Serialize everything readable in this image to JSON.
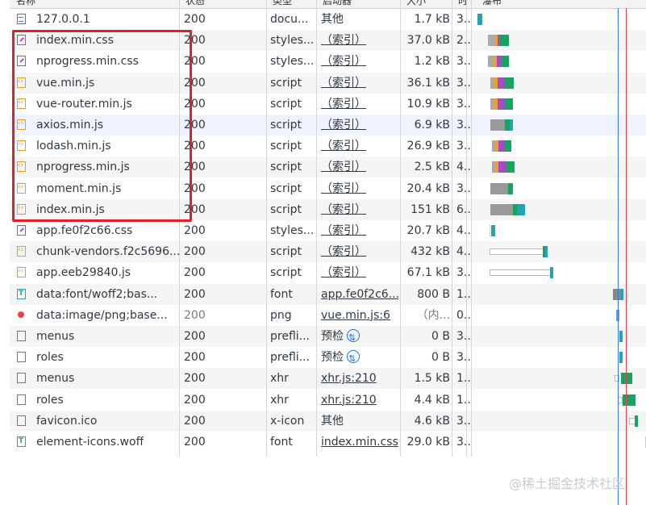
{
  "header": {
    "name": "名称",
    "status": "状态",
    "type": "类型",
    "initiator": "启动器",
    "size": "大小",
    "time": "时",
    "waterfall": "瀑布"
  },
  "rows": [
    {
      "name": "127.0.0.1",
      "icon": "document-icon",
      "status": "200",
      "type": "docu...",
      "initiator": "其他",
      "init_link": false,
      "size": "1.7 kB",
      "time": "3..."
    },
    {
      "name": "index.min.css",
      "icon": "stylesheet-icon",
      "status": "200",
      "type": "styles...",
      "initiator": "（索引）",
      "init_link": true,
      "size": "37.0 kB",
      "time": "2..."
    },
    {
      "name": "nprogress.min.css",
      "icon": "stylesheet-icon",
      "status": "200",
      "type": "styles...",
      "initiator": "（索引）",
      "init_link": true,
      "size": "1.2 kB",
      "time": "3..."
    },
    {
      "name": "vue.min.js",
      "icon": "script-icon",
      "status": "200",
      "type": "script",
      "initiator": "（索引）",
      "init_link": true,
      "size": "36.1 kB",
      "time": "3..."
    },
    {
      "name": "vue-router.min.js",
      "icon": "script-icon",
      "status": "200",
      "type": "script",
      "initiator": "（索引）",
      "init_link": true,
      "size": "10.9 kB",
      "time": "3..."
    },
    {
      "name": "axios.min.js",
      "icon": "script-icon",
      "status": "200",
      "type": "script",
      "initiator": "（索引）",
      "init_link": true,
      "size": "6.9 kB",
      "time": "3..."
    },
    {
      "name": "lodash.min.js",
      "icon": "script-icon",
      "status": "200",
      "type": "script",
      "initiator": "（索引）",
      "init_link": true,
      "size": "26.9 kB",
      "time": "3..."
    },
    {
      "name": "nprogress.min.js",
      "icon": "script-icon",
      "status": "200",
      "type": "script",
      "initiator": "（索引）",
      "init_link": true,
      "size": "2.5 kB",
      "time": "4..."
    },
    {
      "name": "moment.min.js",
      "icon": "script-icon",
      "status": "200",
      "type": "script",
      "initiator": "（索引）",
      "init_link": true,
      "size": "20.4 kB",
      "time": "3..."
    },
    {
      "name": "index.min.js",
      "icon": "script-icon",
      "status": "200",
      "type": "script",
      "initiator": "（索引）",
      "init_link": true,
      "size": "151 kB",
      "time": "6..."
    },
    {
      "name": "app.fe0f2c66.css",
      "icon": "stylesheet-icon",
      "status": "200",
      "type": "styles...",
      "initiator": "（索引）",
      "init_link": true,
      "size": "20.7 kB",
      "time": "4..."
    },
    {
      "name": "chunk-vendors.f2c5696...",
      "icon": "script-icon",
      "status": "200",
      "type": "script",
      "initiator": "（索引）",
      "init_link": true,
      "size": "432 kB",
      "time": "4..."
    },
    {
      "name": "app.eeb29840.js",
      "icon": "script-icon",
      "status": "200",
      "type": "script",
      "initiator": "（索引）",
      "init_link": true,
      "size": "67.1 kB",
      "time": "3..."
    },
    {
      "name": "data:font/woff2;bas...",
      "icon": "font-icon",
      "status": "200",
      "type": "font",
      "initiator": "app.fe0f2c6...",
      "init_link": true,
      "size": "800 B",
      "time": "1..."
    },
    {
      "name": "data:image/png;base...",
      "icon": "image-icon",
      "status": "200",
      "type": "png",
      "initiator": "vue.min.js:6",
      "init_link": true,
      "size": "（内...",
      "time": "0...",
      "muted": true
    },
    {
      "name": "menus",
      "icon": "blank-icon",
      "status": "200",
      "type": "prefli...",
      "initiator": "预检",
      "init_link": false,
      "preflight": true,
      "size": "0 B",
      "time": "3..."
    },
    {
      "name": "roles",
      "icon": "blank-icon",
      "status": "200",
      "type": "prefli...",
      "initiator": "预检",
      "init_link": false,
      "preflight": true,
      "size": "0 B",
      "time": "3..."
    },
    {
      "name": "menus",
      "icon": "blank-icon",
      "status": "200",
      "type": "xhr",
      "initiator": "xhr.js:210",
      "init_link": true,
      "size": "1.5 kB",
      "time": "1..."
    },
    {
      "name": "roles",
      "icon": "blank-icon",
      "status": "200",
      "type": "xhr",
      "initiator": "xhr.js:210",
      "init_link": true,
      "size": "4.4 kB",
      "time": "1..."
    },
    {
      "name": "favicon.ico",
      "icon": "blank-icon",
      "status": "200",
      "type": "x-icon",
      "initiator": "其他",
      "init_link": false,
      "size": "4.6 kB",
      "time": "3..."
    },
    {
      "name": "element-icons.woff",
      "icon": "font-icon",
      "status": "200",
      "type": "font",
      "initiator": "index.min.css",
      "init_link": true,
      "size": "29.0 kB",
      "time": "3..."
    }
  ],
  "colors": {
    "highlight_box": "#e3202a",
    "dom_loaded_line": "#3b78e7",
    "load_line": "#e8414d"
  },
  "watermark": "@稀土掘金技术社区"
}
